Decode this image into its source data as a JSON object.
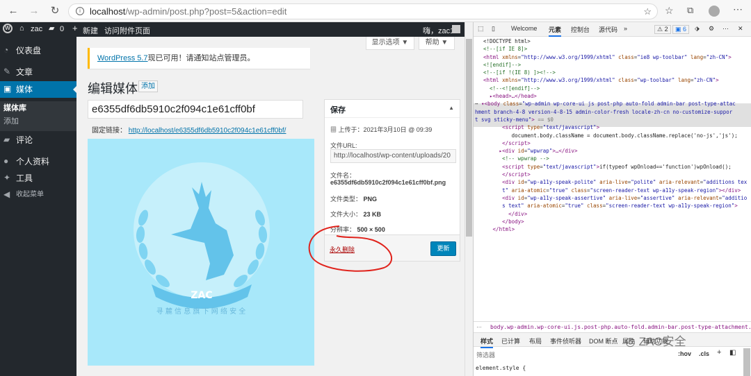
{
  "browser": {
    "url_host": "localhost",
    "url_path": "/wp-admin/post.php?post=5&action=edit"
  },
  "adminbar": {
    "site_name": "zac",
    "comments_count": "0",
    "new_label": "新建",
    "view_label": "访问附件页面",
    "greeting": "嗨，zac1"
  },
  "sidebar": {
    "dashboard": "仪表盘",
    "posts": "文章",
    "media": "媒体",
    "media_library": "媒体库",
    "media_add": "添加",
    "comments": "评论",
    "profile": "个人资料",
    "tools": "工具",
    "collapse": "收起菜单"
  },
  "screen_options": "显示选项 ▼",
  "help": "帮助 ▼",
  "notice": {
    "link": "WordPress 5.7",
    "text": "现已可用！请通知站点管理员。"
  },
  "page": {
    "title": "编辑媒体",
    "add_button": "添加",
    "media_title": "e6355df6db5910c2f094c1e61cff0bf",
    "permalink_label": "固定链接：",
    "permalink_url": "http://localhost/e6355df6db5910c2f094c1e61cff0bf/"
  },
  "preview": {
    "logo_text": "ZAC",
    "slogan": "寻 麓 信 息 旗 下 网 络 安 全"
  },
  "save_box": {
    "title": "保存",
    "uploaded": "上传于：2021年3月10日 @ 09:39",
    "url_label": "文件URL:",
    "url_value": "http://localhost/wp-content/uploads/20",
    "filename_label": "文件名：",
    "filename_value": "e6355df6db5910c2f094c1e61cff0bf.png",
    "type_label": "文件类型：",
    "type_value": "PNG",
    "size_label": "文件大小：",
    "size_value": "23 KB",
    "res_label": "分辨率：",
    "res_value": "500 × 500",
    "delete": "永久删除",
    "update": "更新"
  },
  "devtools": {
    "tabs": [
      "Welcome",
      "元素",
      "控制台",
      "源代码"
    ],
    "warnings": "2",
    "issues": "6",
    "breadcrumb": "body.wp-admin.wp-core-ui.js.post-php.auto-fold.admin-bar.post-type-attachment.branch-4-8.v",
    "subtabs": [
      "样式",
      "已计算",
      "布局",
      "事件侦听器",
      "DOM 断点",
      "属性",
      "辅助功能"
    ],
    "filter_placeholder": "筛选器",
    "hov": ":hov",
    "cls": ".cls",
    "style_rule": "element.style {"
  },
  "watermark": "ZAC安全"
}
